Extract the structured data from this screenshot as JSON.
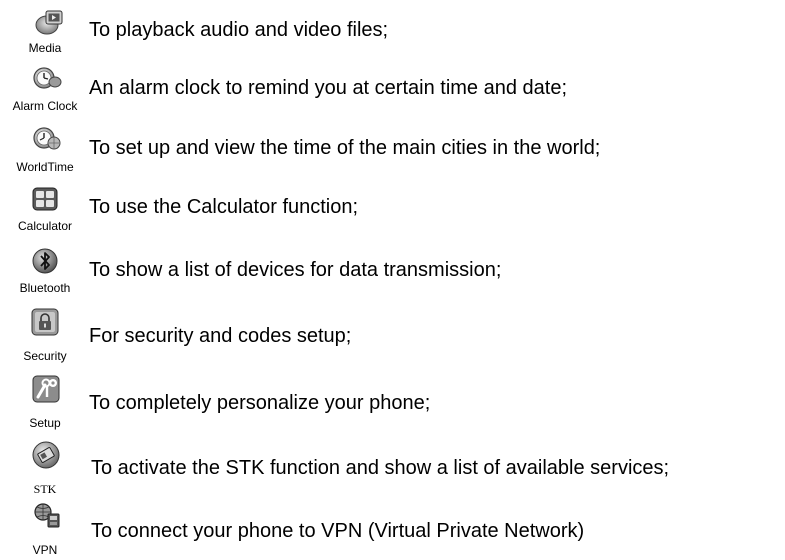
{
  "items": [
    {
      "icon": "media-player-icon",
      "label": "Media",
      "text": "To playback audio and video files;"
    },
    {
      "icon": "alarm-clock-icon",
      "label": "Alarm Clock",
      "text": "An alarm clock to remind you at certain time and date;"
    },
    {
      "icon": "world-time-icon",
      "label": "WorldTime",
      "text": "To set up and view the time of the main cities in the world;"
    },
    {
      "icon": "calculator-icon",
      "label": "Calculator",
      "text": "To use the Calculator function;"
    },
    {
      "icon": "bluetooth-icon",
      "label": "Bluetooth",
      "text": "To show a list of devices for data transmission;"
    },
    {
      "icon": "security-lock-icon",
      "label": "Security",
      "text": "For security and codes setup;"
    },
    {
      "icon": "setup-tools-icon",
      "label": "Setup",
      "text": "To completely personalize your phone;"
    },
    {
      "icon": "stk-sim-card-icon",
      "label": "STK",
      "text": "To activate the STK function and show a list of available services;"
    },
    {
      "icon": "vpn-network-icon",
      "label": "VPN",
      "text": "To connect your phone to VPN (Virtual Private Network)"
    }
  ]
}
